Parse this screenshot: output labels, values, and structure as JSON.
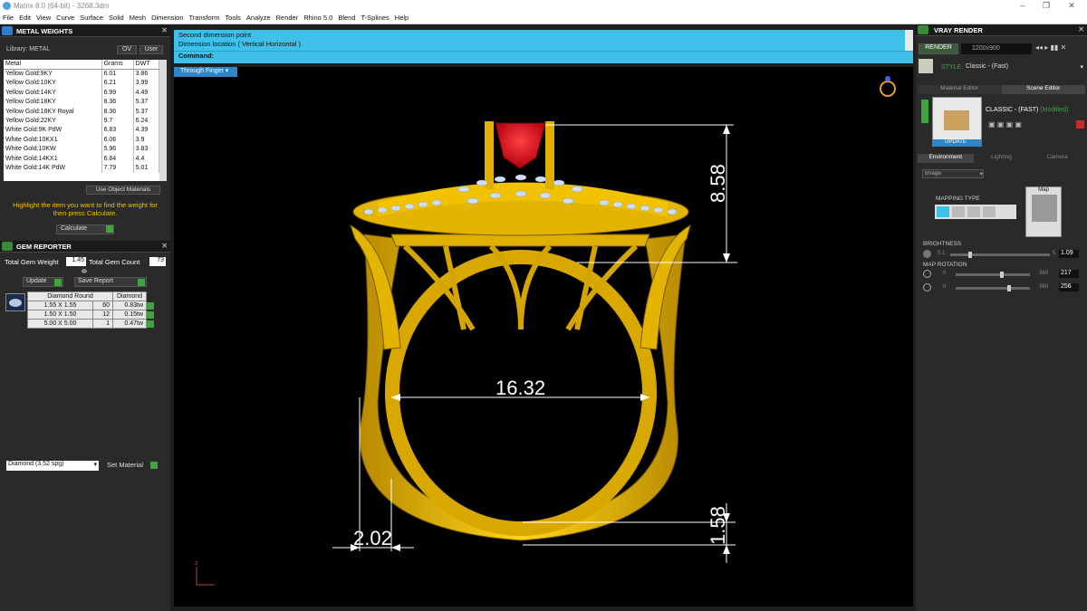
{
  "window": {
    "title": "Matrix 8.0 (64-bit) - 3268.3dm"
  },
  "menu": [
    "File",
    "Edit",
    "View",
    "Curve",
    "Surface",
    "Solid",
    "Mesh",
    "Dimension",
    "Transform",
    "Tools",
    "Analyze",
    "Render",
    "Rhino 5.0",
    "Blend",
    "T-Splines",
    "Help"
  ],
  "metal": {
    "title": "METAL WEIGHTS",
    "library_label": "Library: METAL",
    "toggle_ov": "OV",
    "toggle_user": "User",
    "columns": [
      "Metal",
      "Grams",
      "DWT"
    ],
    "rows": [
      [
        "Yellow Gold:9KY",
        "6.01",
        "3.86"
      ],
      [
        "Yellow Gold:10KY",
        "6.21",
        "3.99"
      ],
      [
        "Yellow Gold:14KY",
        "6.99",
        "4.49"
      ],
      [
        "Yellow Gold:18KY",
        "8.36",
        "5.37"
      ],
      [
        "Yellow Gold:18KY Royal",
        "8.36",
        "5.37"
      ],
      [
        "Yellow Gold:22KY",
        "9.7",
        "6.24"
      ],
      [
        "White Gold:9K PdW",
        "6.83",
        "4.39"
      ],
      [
        "White Gold:10KX1",
        "6.06",
        "3.9"
      ],
      [
        "White Gold:10KW",
        "5.96",
        "3.83"
      ],
      [
        "White Gold:14KX1",
        "6.84",
        "4.4"
      ],
      [
        "White Gold:14K PdW",
        "7.79",
        "5.01"
      ]
    ],
    "use_object": "Use Object Materials",
    "hint": "Highlight the item you want to find the weight for then press Calculate.",
    "calculate": "Calculate"
  },
  "gem": {
    "title": "GEM REPORTER",
    "total_weight_label": "Total Gem Weight",
    "total_weight": "1.45",
    "total_count_label": "Total Gem Count",
    "total_count": "73",
    "update": "Update",
    "save": "Save Report",
    "cols": [
      "Diamond Round",
      "Diamond"
    ],
    "rows": [
      [
        "1.55 X 1.55",
        "60",
        "0.83tw"
      ],
      [
        "1.50 X 1.50",
        "12",
        "0.15tw"
      ],
      [
        "5.00 X 5.00",
        "1",
        "0.47tw"
      ]
    ],
    "material_select": "Diamond      (3.52 spg)",
    "set_material": "Set Material"
  },
  "command": {
    "line1": "Second dimension point",
    "line2": "Dimension location ( Vertical  Horizontal )",
    "label": "Command:"
  },
  "viewport": {
    "label": "Through Finger",
    "dims": [
      "8.58",
      "16.32",
      "2.02",
      "1.58"
    ]
  },
  "vray": {
    "title": "VRAY RENDER",
    "render": "RENDER",
    "resolution": "1200x900",
    "style_label": "STYLE:",
    "style_value": "Classic - (Fast)",
    "tabs": [
      "Material Editor",
      "Scene Editor"
    ],
    "preset": "CLASSIC - (FAST)",
    "modified": "(Modified)",
    "update": "UPDATE",
    "subtabs": [
      "Environment",
      "Lighting",
      "Camera"
    ],
    "env_select": "Image",
    "mapping_type": "MAPPING TYPE",
    "map_label": "Map",
    "brightness": "BRIGHTNESS",
    "b_min": "0.1",
    "b_max": "5",
    "b_val": "1.09",
    "map_rotation": "MAP ROTATION",
    "r1_min": "0",
    "r1_max": "360",
    "r1_val": "217",
    "r2_min": "0",
    "r2_max": "360",
    "r2_val": "256"
  },
  "colors": {
    "accent": "#3ec0e8",
    "gold": "#f2c200",
    "ruby": "#e0101a",
    "green": "#3fa33f"
  }
}
